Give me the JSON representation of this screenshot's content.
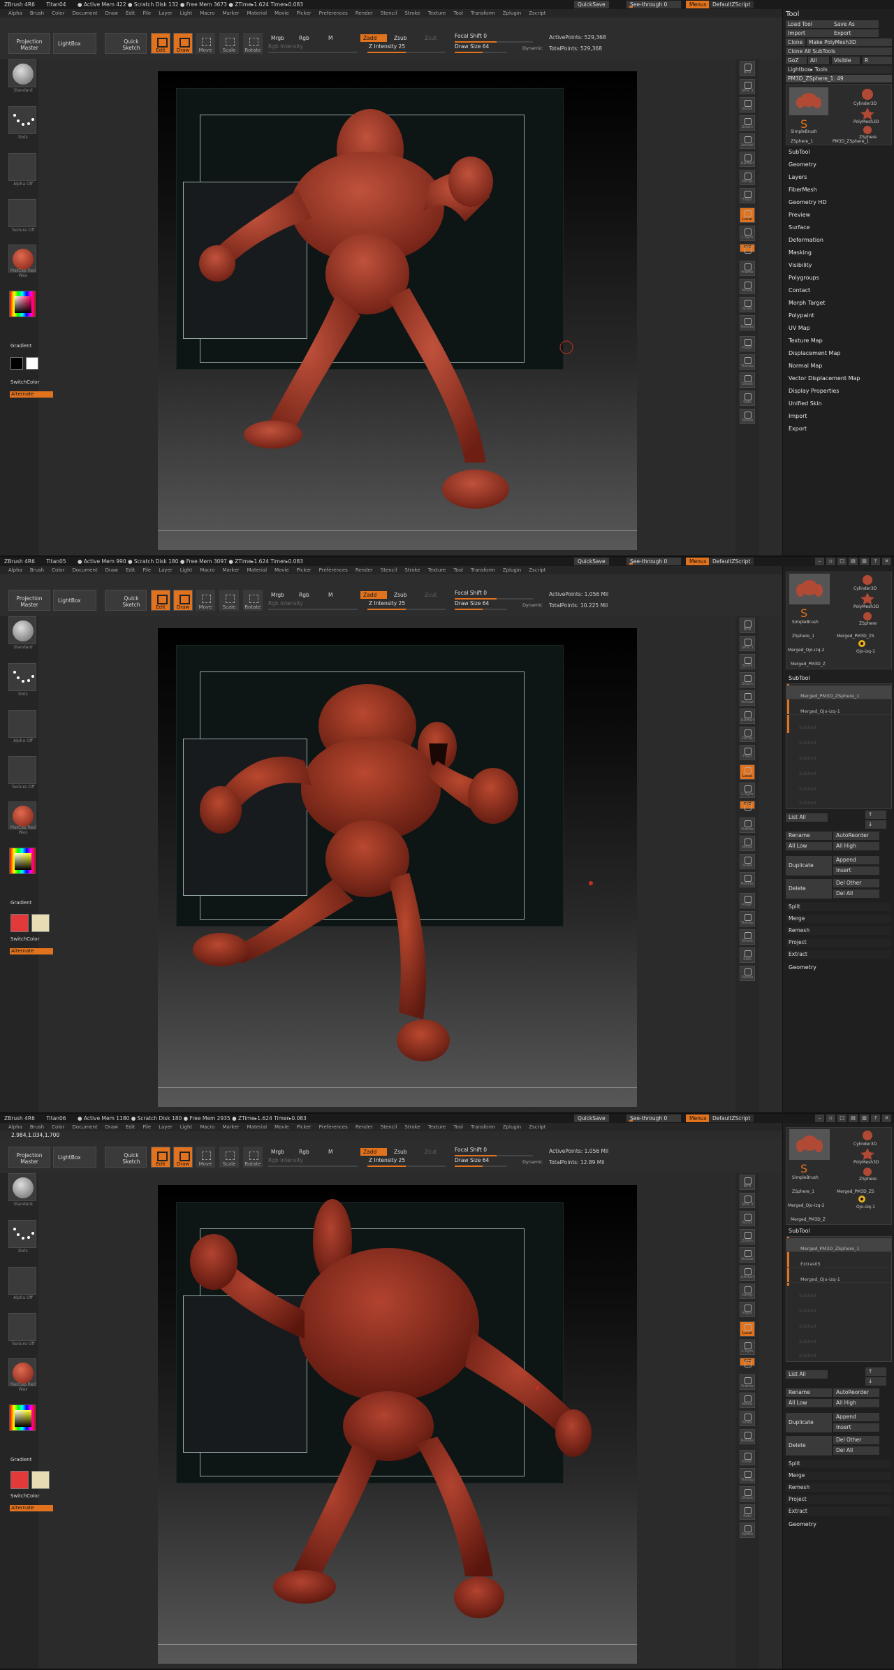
{
  "accent": "#e2731e",
  "shots": [
    {
      "status": [
        "ZBrush 4R6",
        "Titan04",
        "● Active Mem 422 ● Scratch Disk 132 ● Free Mem 3673 ● ZTime▸1.624 Timer▸0.083"
      ],
      "active_points": "ActivePoints: 529,368",
      "total_points": "TotalPoints: 529,368"
    },
    {
      "status": [
        "ZBrush 4R6",
        "Titan05",
        "● Active Mem 990 ● Scratch Disk 180 ● Free Mem 3097 ● ZTime▸1.624 Timer▸0.083"
      ],
      "active_points": "ActivePoints: 1.056 Mil",
      "total_points": "TotalPoints: 10.225 Mil"
    },
    {
      "status": [
        "ZBrush 4R6",
        "Titan06",
        "● Active Mem 1180 ● Scratch Disk 180 ● Free Mem 2935 ● ZTime▸1.624 Timer▸0.083"
      ],
      "active_points": "ActivePoints: 1.056 Mil",
      "total_points": "TotalPoints: 12.89 Mil"
    }
  ],
  "coords_readout": "2.984,1.034,1.700",
  "topright": {
    "quicksave": "QuickSave",
    "seethrough": "See-through 0",
    "menus": "Menus",
    "script": "DefaultZScript"
  },
  "menubar": [
    "Alpha",
    "Brush",
    "Color",
    "Document",
    "Draw",
    "Edit",
    "File",
    "Layer",
    "Light",
    "Macro",
    "Marker",
    "Material",
    "Movie",
    "Picker",
    "Preferences",
    "Render",
    "Stencil",
    "Stroke",
    "Texture",
    "Tool",
    "Transform",
    "Zplugin",
    "Zscript"
  ],
  "toolbar": {
    "projection": "Projection Master",
    "lightbox": "LightBox",
    "quicksketch": "Quick Sketch",
    "modes": [
      "Edit",
      "Draw",
      "Move",
      "Scale",
      "Rotate"
    ],
    "mrgb": "Mrgb",
    "rgb": "Rgb",
    "m": "M",
    "zadd": "Zadd",
    "zsub": "Zsub",
    "zcut": "Zcut",
    "rgb_intensity": "Rgb Intensity",
    "z_intensity": "Z Intensity 25",
    "focal_shift": "Focal Shift 0",
    "draw_size": "Draw Size 64",
    "dynamic": "Dynamic"
  },
  "left_shelf": {
    "brush": "Standard",
    "stroke": "Dots",
    "alpha": "Alpha Off",
    "texture": "Texture Off",
    "material": "MatCap Red Wax",
    "gradient": "Gradient",
    "switchcolor": "SwitchColor",
    "alternate": "Alternate"
  },
  "right_shelf": [
    "BPR",
    "SPix 3",
    "Scroll",
    "Zoom",
    "Actual",
    "AAHalf",
    "Persp",
    "Floor",
    "Local",
    "L.Sym",
    "XYZ",
    "Frame",
    "Move",
    "Scale",
    "Rotate",
    "PolyF",
    "Transp",
    "Ghost",
    "Solo",
    "Xpose"
  ],
  "tool_panel": {
    "title": "Tool",
    "load": "Load Tool",
    "saveas": "Save As",
    "import": "Import",
    "export": "Export",
    "clone": "Clone",
    "make_polymesh": "Make PolyMesh3D",
    "clone_all": "Clone All SubTools",
    "goz": "GoZ",
    "all": "All",
    "visible": "Visible",
    "r": "R",
    "lightbox_tools": "Lightbox▸ Tools",
    "current_tool": "PM3D_ZSphere_1. 49",
    "gallery1": [
      "PM3D_ZSphere_1",
      "Cylinder3D",
      "PolyMesh3D",
      "SimpleBrush",
      "ZSphere",
      "ZSphere_1",
      "PM3D_ZSphere_1"
    ],
    "gallery2": [
      "PM3D_ZSphere_1",
      "Cylinder3D",
      "PolyMesh3D",
      "SimpleBrush",
      "ZSphere",
      "ZSphere_1",
      "Merged_PM3D_ZS",
      "Merged_Ojo-izq-2",
      "Ojo-izq-1",
      "Merged_PM3D_Z"
    ],
    "sections": [
      "SubTool",
      "Geometry",
      "Layers",
      "FiberMesh",
      "Geometry HD",
      "Preview",
      "Surface",
      "Deformation",
      "Masking",
      "Visibility",
      "Polygroups",
      "Contact",
      "Morph Target",
      "Polypaint",
      "UV Map",
      "Texture Map",
      "Displacement Map",
      "Normal Map",
      "Vector Displacement Map",
      "Display Properties",
      "Unified Skin",
      "Import",
      "Export"
    ],
    "subtool_label": "SubTool",
    "subtools2": [
      "Merged_PM3D_ZSphere_1",
      "Merged_Ojo-izq-1"
    ],
    "subtools3": [
      "Merged_PM3D_ZSphere_1",
      "Extras05",
      "Merged_Ojo-izq-1"
    ],
    "empty_slot": "Subtool",
    "list_all": "List All",
    "rename": "Rename",
    "autoreorder": "AutoReorder",
    "all_low": "All Low",
    "all_high": "All High",
    "duplicate": "Duplicate",
    "append": "Append",
    "insert": "Insert",
    "delete": "Delete",
    "del_other": "Del Other",
    "del_all": "Del All",
    "ops": [
      "Split",
      "Merge",
      "Remesh",
      "Project",
      "Extract"
    ],
    "geometry": "Geometry"
  }
}
